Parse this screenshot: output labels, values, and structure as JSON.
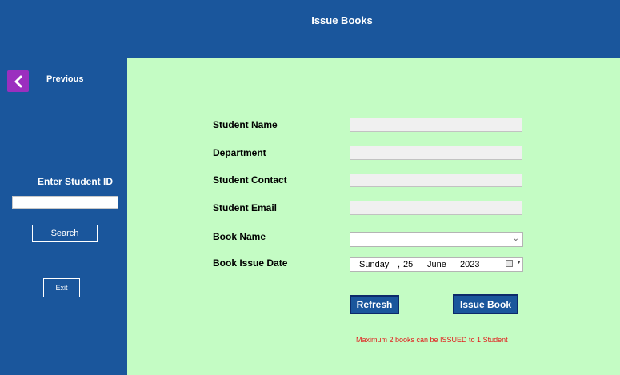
{
  "window": {
    "title": "Issue Books"
  },
  "sidebar": {
    "previous_label": "Previous",
    "student_id_label": "Enter Student ID",
    "student_id_value": "",
    "search_label": "Search",
    "exit_label": "Exit"
  },
  "form": {
    "student_name_label": "Student Name",
    "department_label": "Department",
    "student_contact_label": "Student Contact",
    "student_email_label": "Student Email",
    "book_name_label": "Book Name",
    "book_issue_date_label": "Book Issue Date",
    "student_name_value": "",
    "department_value": "",
    "student_contact_value": "",
    "student_email_value": "",
    "book_name_value": "",
    "issue_date": {
      "weekday": "Sunday",
      "day": "25",
      "month": "June",
      "year": "2023"
    },
    "refresh_label": "Refresh",
    "issue_label": "Issue Book",
    "note": "Maximum 2 books can be ISSUED to 1 Student"
  },
  "colors": {
    "sidebar_bg": "#1a569c",
    "panel_bg": "#c4fcc4",
    "back_button": "#9b2fbf",
    "note_text": "#e21a1a"
  },
  "icons": {
    "back": "chevron-left-icon",
    "dropdown": "chevron-down-icon",
    "calendar": "calendar-icon"
  }
}
